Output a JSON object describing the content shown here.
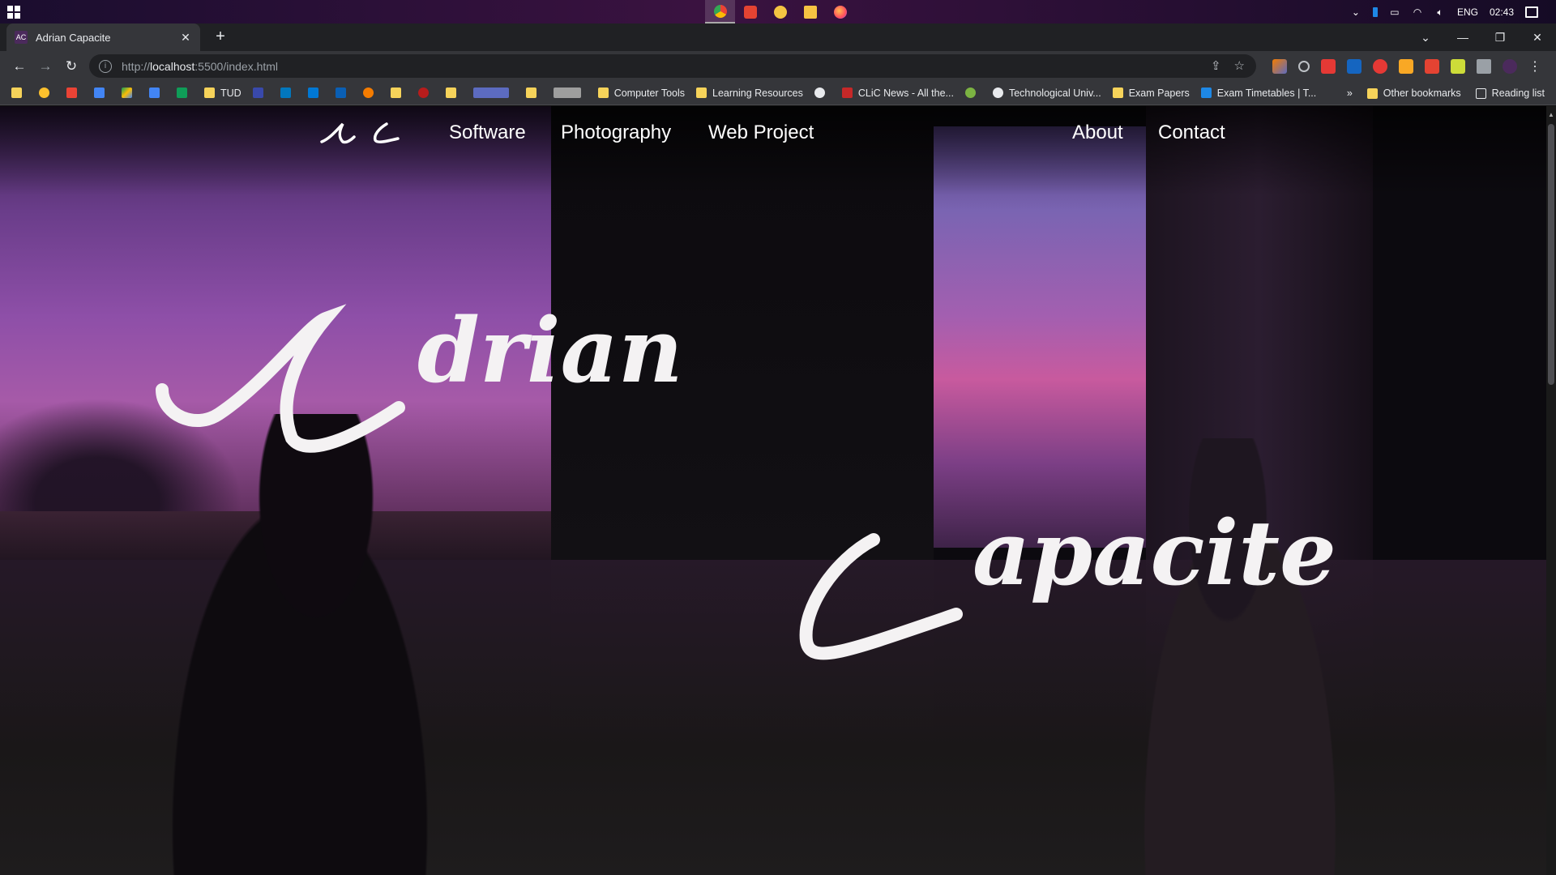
{
  "taskbar": {
    "tray": {
      "language": "ENG",
      "time": "02:43"
    }
  },
  "browser": {
    "tab": {
      "title": "Adrian Capacite",
      "favicon_text": "AC"
    },
    "address": {
      "scheme": "http://",
      "host": "localhost",
      "rest": ":5500/index.html"
    },
    "bookmarks": [
      {
        "label": "TUD",
        "icon": "folder-icon"
      },
      {
        "label": "Computer Tools",
        "icon": "folder-icon"
      },
      {
        "label": "Learning Resources",
        "icon": "folder-icon"
      },
      {
        "label": "CLiC News - All the...",
        "icon": "site-icon"
      },
      {
        "label": "Technological Univ...",
        "icon": "globe-icon"
      },
      {
        "label": "Exam Papers",
        "icon": "folder-icon"
      },
      {
        "label": "Exam Timetables | T...",
        "icon": "site-icon"
      }
    ],
    "bookmarks_right": {
      "other": "Other bookmarks",
      "reading": "Reading list"
    }
  },
  "site": {
    "nav": {
      "software": "Software",
      "photography": "Photography",
      "web_project": "Web Project",
      "about": "About",
      "contact": "Contact"
    },
    "hero": {
      "first_name_rest": "drian",
      "last_name_rest": "apacite"
    }
  }
}
